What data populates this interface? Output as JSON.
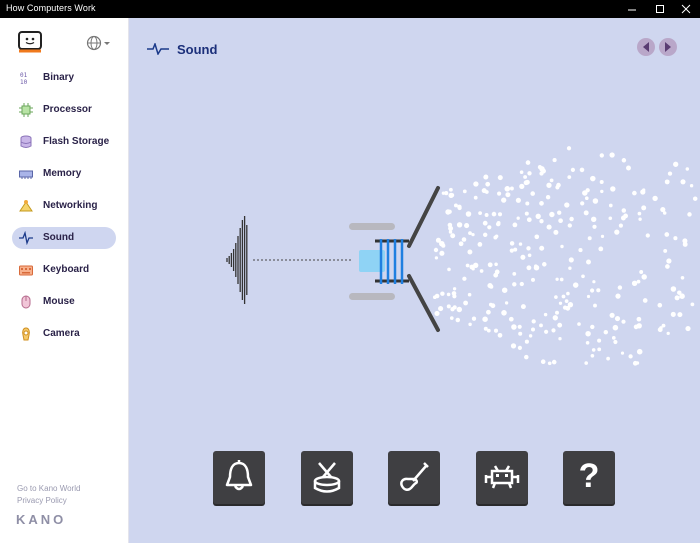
{
  "window": {
    "title": "How Computers Work"
  },
  "sidebar": {
    "items": [
      {
        "label": "Binary",
        "icon": "binary-icon"
      },
      {
        "label": "Processor",
        "icon": "processor-icon"
      },
      {
        "label": "Flash Storage",
        "icon": "flash-storage-icon"
      },
      {
        "label": "Memory",
        "icon": "memory-icon"
      },
      {
        "label": "Networking",
        "icon": "networking-icon"
      },
      {
        "label": "Sound",
        "icon": "sound-wave-icon",
        "active": true
      },
      {
        "label": "Keyboard",
        "icon": "keyboard-icon"
      },
      {
        "label": "Mouse",
        "icon": "mouse-icon"
      },
      {
        "label": "Camera",
        "icon": "camera-icon"
      }
    ],
    "footer": {
      "kano_world": "Go to Kano World",
      "privacy": "Privacy Policy",
      "brand": "KANO"
    }
  },
  "main": {
    "title": "Sound",
    "sound_buttons": [
      {
        "icon": "bell-icon"
      },
      {
        "icon": "drum-icon"
      },
      {
        "icon": "guitar-icon"
      },
      {
        "icon": "space-invader-icon"
      },
      {
        "icon": "question-icon",
        "label": "?"
      }
    ]
  },
  "colors": {
    "sidebar_active": "#cfd6f0",
    "main_bg": "#cfd6ef",
    "title_blue": "#1b2f7a",
    "button_dark": "#3f3f42",
    "coil_blue": "#1f7fe0"
  }
}
